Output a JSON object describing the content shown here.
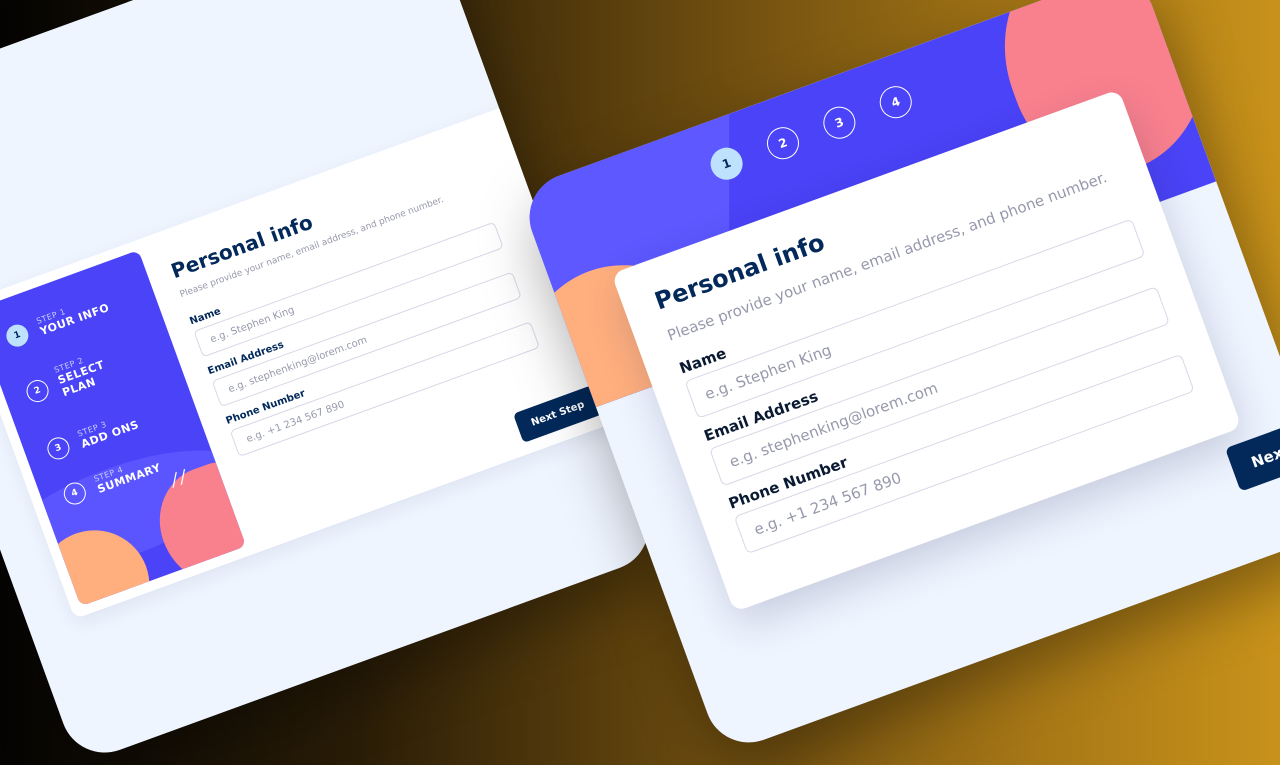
{
  "form": {
    "title": "Personal info",
    "subtitle": "Please provide your name, email address, and phone number.",
    "fields": {
      "name": {
        "label": "Name",
        "placeholder": "e.g. Stephen King"
      },
      "email": {
        "label": "Email Address",
        "placeholder": "e.g. stephenking@lorem.com"
      },
      "phone": {
        "label": "Phone Number",
        "placeholder": "e.g. +1 234 567 890"
      }
    },
    "next_label": "Next Step"
  },
  "steps": [
    {
      "number": "1",
      "caption": "STEP 1",
      "label": "YOUR INFO"
    },
    {
      "number": "2",
      "caption": "STEP 2",
      "label": "SELECT PLAN"
    },
    {
      "number": "3",
      "caption": "STEP 3",
      "label": "ADD ONS"
    },
    {
      "number": "4",
      "caption": "STEP 4",
      "label": "SUMMARY"
    }
  ],
  "mobile_next_label": "Next St",
  "colors": {
    "primary": "#4a43f7",
    "navy": "#02295a",
    "active_step": "#bee2fd",
    "peach": "#ffaf7e",
    "pink": "#f9818e",
    "tile_bg": "#eff5ff"
  },
  "icons": {
    "sparkle": "sparkle-icon"
  }
}
